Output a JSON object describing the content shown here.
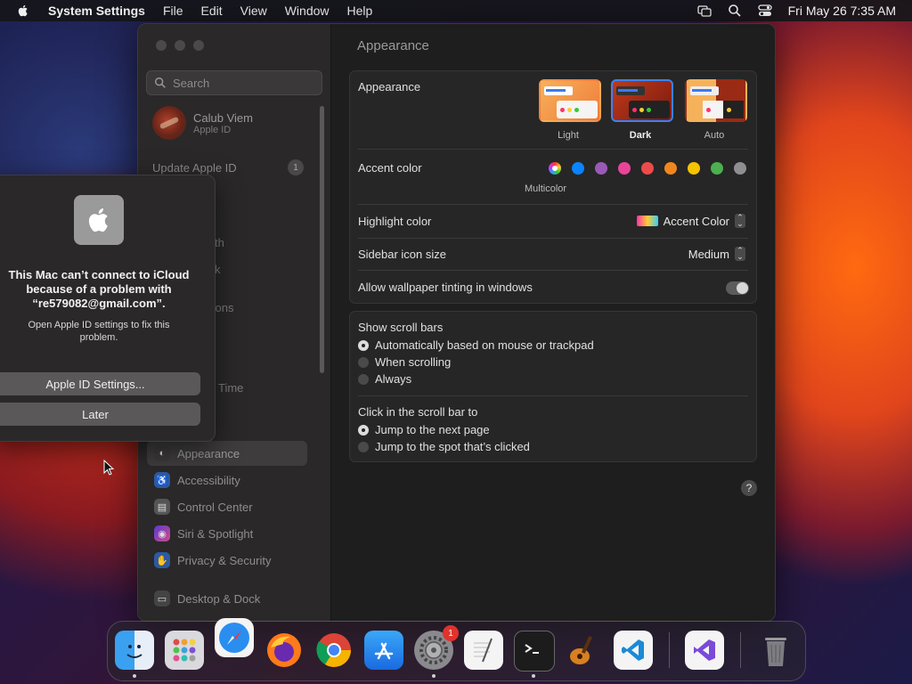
{
  "menubar": {
    "app_name": "System Settings",
    "menus": [
      "File",
      "Edit",
      "View",
      "Window",
      "Help"
    ],
    "datetime": "Fri May 26  7:35 AM"
  },
  "sidebar": {
    "search_placeholder": "Search",
    "profile_name": "Calub Viem",
    "profile_sub": "Apple ID",
    "update_label": "Update Apple ID",
    "update_count": "1",
    "partial_items": [
      "th",
      "k",
      "tions",
      "Time",
      "l"
    ],
    "items": [
      {
        "label": "Appearance",
        "icon": "appearance-icon",
        "selected": true
      },
      {
        "label": "Accessibility",
        "icon": "accessibility-icon"
      },
      {
        "label": "Control Center",
        "icon": "control-center-icon"
      },
      {
        "label": "Siri & Spotlight",
        "icon": "siri-icon"
      },
      {
        "label": "Privacy & Security",
        "icon": "privacy-hand-icon"
      },
      {
        "label": "Desktop & Dock",
        "icon": "desktop-dock-icon"
      }
    ]
  },
  "content": {
    "title": "Appearance",
    "appearance_label": "Appearance",
    "modes": [
      {
        "label": "Light",
        "selected": false
      },
      {
        "label": "Dark",
        "selected": true
      },
      {
        "label": "Auto",
        "selected": false
      }
    ],
    "accent_label": "Accent color",
    "accent_selected_name": "Multicolor",
    "accent_colors": [
      "#ff3b30-multi",
      "#0a84ff",
      "#9b59b6",
      "#e8459a",
      "#ef4a4a",
      "#f0871e",
      "#f5c400",
      "#4caf50",
      "#8e8e93"
    ],
    "highlight_label": "Highlight color",
    "highlight_value": "Accent Color",
    "sidebar_icon_label": "Sidebar icon size",
    "sidebar_icon_value": "Medium",
    "tinting_label": "Allow wallpaper tinting in windows",
    "scroll_label": "Show scroll bars",
    "scroll_options": [
      {
        "label": "Automatically based on mouse or trackpad",
        "selected": true
      },
      {
        "label": "When scrolling",
        "selected": false
      },
      {
        "label": "Always",
        "selected": false
      }
    ],
    "click_label": "Click in the scroll bar to",
    "click_options": [
      {
        "label": "Jump to the next page",
        "selected": true
      },
      {
        "label": "Jump to the spot that’s clicked",
        "selected": false
      }
    ],
    "help": "?"
  },
  "alert": {
    "title": "This Mac can’t connect to iCloud because of a problem with “re579082@gmail.com”.",
    "message": "Open Apple ID settings to fix this problem.",
    "primary_button": "Apple ID Settings...",
    "secondary_button": "Later"
  },
  "dock": {
    "apps": [
      "Finder",
      "Launchpad",
      "Safari",
      "Firefox",
      "Chrome",
      "App Store",
      "System Settings",
      "TextEdit",
      "Terminal",
      "GarageBand",
      "Visual Studio Code",
      "Visual Studio",
      "Trash"
    ],
    "settings_badge": "1"
  }
}
